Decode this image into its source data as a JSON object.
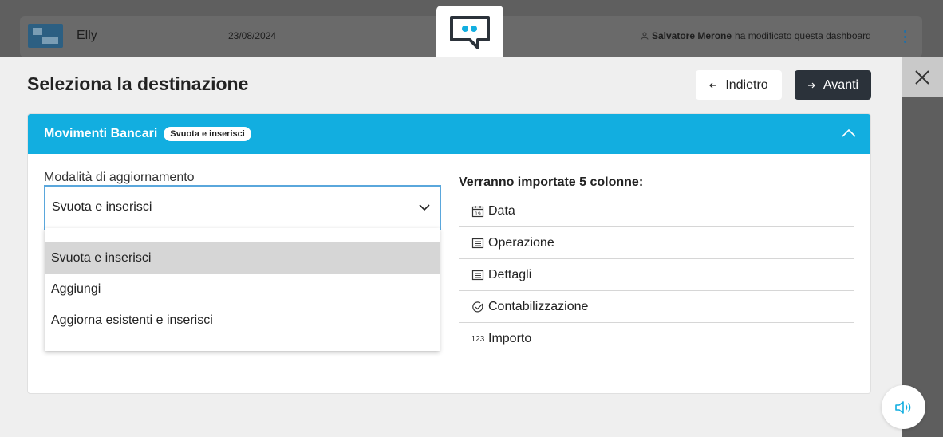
{
  "background": {
    "dashboard_name": "Elly",
    "date": "23/08/2024",
    "user_name": "Salvatore Merone",
    "user_action": "ha modificato questa dashboard",
    "logo_color": "#2c5f82"
  },
  "modal": {
    "title": "Seleziona la destinazione",
    "back_label": "Indietro",
    "next_label": "Avanti",
    "panel": {
      "title": "Movimenti Bancari",
      "badge": "Svuota e inserisci",
      "accent_color": "#12aee0"
    },
    "field": {
      "label": "Modalità di aggiornamento",
      "value": "Svuota e inserisci",
      "options": [
        "Svuota e inserisci",
        "Aggiungi",
        "Aggiorna esistenti e inserisci"
      ],
      "selected_index": 0
    },
    "columns": {
      "title": "Verranno importate 5 colonne:",
      "items": [
        {
          "name": "Data",
          "icon": "calendar-icon",
          "glyph": "19"
        },
        {
          "name": "Operazione",
          "icon": "text-icon",
          "glyph": ""
        },
        {
          "name": "Dettagli",
          "icon": "text-icon",
          "glyph": ""
        },
        {
          "name": "Contabilizzazione",
          "icon": "check-circle-icon",
          "glyph": ""
        },
        {
          "name": "Importo",
          "icon": "number-icon",
          "glyph": "123"
        }
      ]
    }
  }
}
